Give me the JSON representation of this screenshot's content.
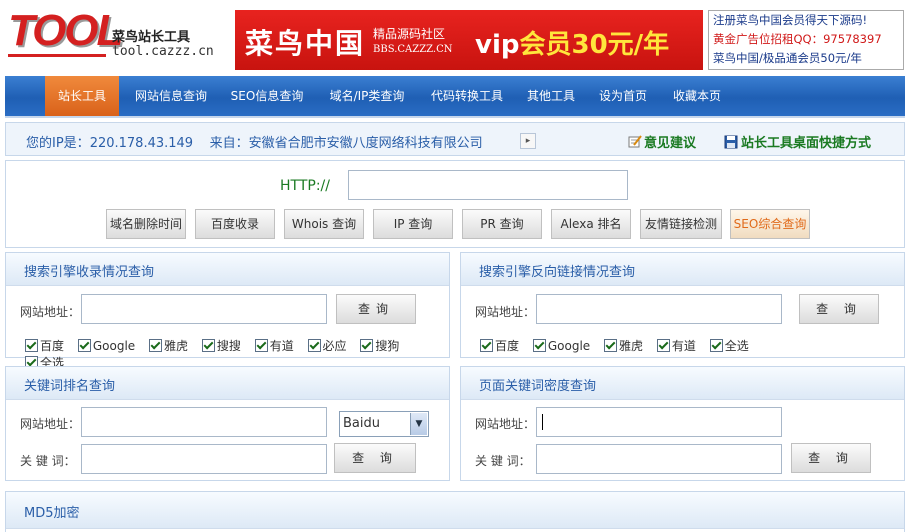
{
  "header": {
    "logo": "TOOL",
    "site_name": "菜鸟站长工具",
    "site_url": "tool.cazzz.cn",
    "banner": {
      "name": "菜鸟中国",
      "sub": "精品源码社区",
      "url": "BBS.CAZZZ.CN",
      "vip_prefix": "vip",
      "vip_text": "会员30元/年"
    },
    "ad_lines": [
      "注册菜鸟中国会员得天下源码!",
      "黄金广告位招租QQ：97578397",
      "菜鸟中国/极品通会员50元/年"
    ]
  },
  "nav": {
    "items": [
      "站长工具",
      "网站信息查询",
      "SEO信息查询",
      "域名/IP类查询",
      "代码转换工具",
      "其他工具",
      "设为首页",
      "收藏本页"
    ]
  },
  "ipbar": {
    "ip_label": "您的IP是：",
    "ip": "220.178.43.149",
    "from_label": "来自：",
    "from": "安徽省合肥市安徽八度网络科技有限公司",
    "arrow": "▸",
    "suggest": "意见建议",
    "desktop": "站长工具桌面快捷方式"
  },
  "http": {
    "label": "HTTP://",
    "value": "",
    "buttons": [
      "域名删除时间",
      "百度收录",
      "Whois 查询",
      "IP 查询",
      "PR 查询",
      "Alexa 排名",
      "友情链接检测",
      "SEO综合查询"
    ]
  },
  "panels": {
    "index": {
      "title": "搜索引擎收录情况查询",
      "url_label": "网站地址：",
      "url_value": "",
      "button": "查询",
      "checks": [
        "百度",
        "Google",
        "雅虎",
        "搜搜",
        "有道",
        "必应",
        "搜狗",
        "全选"
      ]
    },
    "backlink": {
      "title": "搜索引擎反向链接情况查询",
      "url_label": "网站地址：",
      "url_value": "",
      "button": "查 询",
      "checks": [
        "百度",
        "Google",
        "雅虎",
        "有道",
        "全选"
      ]
    },
    "rank": {
      "title": "关键词排名查询",
      "url_label": "网站地址：",
      "keyword_label": "关 键 词：",
      "url_value": "",
      "keyword_value": "",
      "engine": "Baidu",
      "button": "查 询"
    },
    "density": {
      "title": "页面关键词密度查询",
      "url_label": "网站地址：",
      "keyword_label": "关 键 词：",
      "url_value": "",
      "keyword_value": "",
      "button": "查 询"
    },
    "md5": {
      "title": "MD5加密"
    }
  },
  "icons": {
    "suggest": "pencil-note-icon",
    "desktop": "floppy-disk-icon",
    "dropdown": "chevron-down-icon",
    "check": "checkmark-icon"
  },
  "colors": {
    "logo_red": "#d42020",
    "nav_blue": "#2a6dc4",
    "nav_active": "#e87428",
    "link_blue": "#2a5ea8",
    "green": "#1a7a22",
    "seo_orange": "#e06a1a"
  }
}
